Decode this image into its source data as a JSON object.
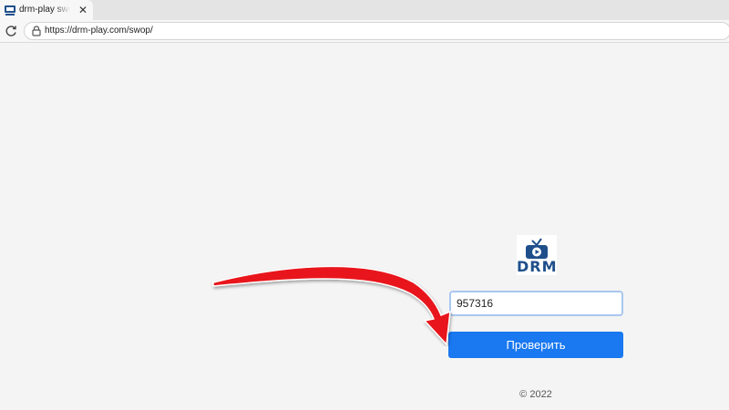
{
  "browser": {
    "tab": {
      "title": "drm-play swop",
      "favicon": "tv-favicon-icon",
      "close_label": "✕"
    },
    "toolbar": {
      "reload_icon": "reload-icon",
      "lock_icon": "lock-icon",
      "url": "https://drm-play.com/swop/"
    }
  },
  "page": {
    "logo": {
      "text": "DRM",
      "icon": "tv-play-icon",
      "color": "#1f4f8b"
    },
    "code_input": {
      "value": "957316"
    },
    "check_button": {
      "label": "Проверить",
      "color": "#1a78f0"
    },
    "footer": {
      "text": "© 2022"
    }
  },
  "annotation": {
    "arrow_color": "#e8141b",
    "icon": "red-arrow-icon"
  }
}
